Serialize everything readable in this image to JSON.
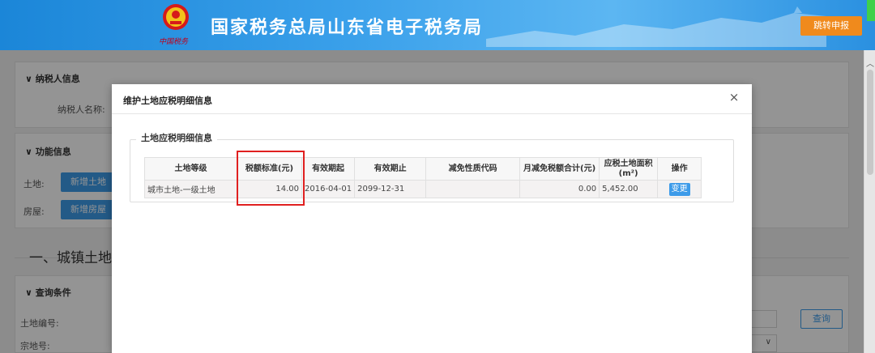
{
  "header": {
    "site_title": "国家税务总局山东省电子税务局",
    "emblem_caption": "中国税务",
    "jump_button": "跳转申报",
    "emblem_icon": "tax-emblem-icon"
  },
  "background": {
    "taxpayer_section": "纳税人信息",
    "taxpayer_name_label": "纳税人名称:",
    "function_section": "功能信息",
    "land_label": "土地:",
    "add_land_button": "新增土地",
    "house_label": "房屋:",
    "add_house_button": "新增房屋",
    "urban_land_heading": "一、城镇土地",
    "query_section": "查询条件",
    "land_no_label": "土地编号:",
    "parcel_no_label": "宗地号:",
    "query_button": "查询"
  },
  "modal": {
    "title": "维护土地应税明细信息",
    "close": "×",
    "group_title": "土地应税明细信息",
    "table": {
      "headers": [
        "土地等级",
        "税额标准(元)",
        "有效期起",
        "有效期止",
        "减免性质代码",
        "月减免税额合计(元)",
        "应税土地面积(m²)",
        "操作"
      ],
      "rows": [
        {
          "land_grade": "城市土地-一级土地",
          "tax_standard": "14.00",
          "valid_from": "2016-04-01",
          "valid_to": "2099-12-31",
          "exemption_code": "",
          "monthly_exemption": "0.00",
          "taxable_area": "5,452.00",
          "action": "变更"
        }
      ]
    }
  },
  "colors": {
    "header_blue": "#1b86d8",
    "accent_orange": "#f08a1c",
    "button_blue": "#3d9be9",
    "highlight_red": "#e02020"
  }
}
